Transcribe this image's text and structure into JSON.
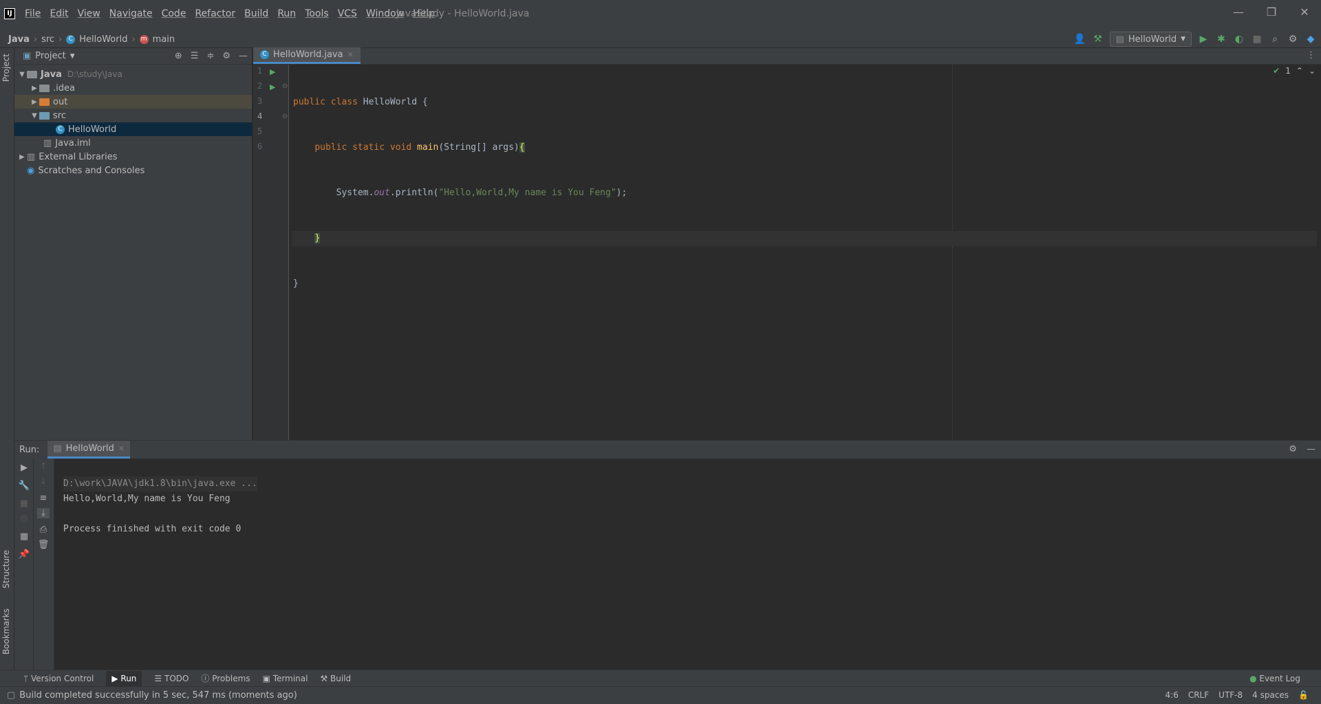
{
  "window": {
    "title": "JavaStudy - HelloWorld.java",
    "logo": "IJ",
    "controls": [
      "—",
      "❐",
      "✕"
    ]
  },
  "menu": [
    "File",
    "Edit",
    "View",
    "Navigate",
    "Code",
    "Refactor",
    "Build",
    "Run",
    "Tools",
    "VCS",
    "Window",
    "Help"
  ],
  "breadcrumb": {
    "project": "Java",
    "folder": "src",
    "class": "HelloWorld",
    "method": "main"
  },
  "toolbar": {
    "run_config": "HelloWorld",
    "icons": [
      "user-icon",
      "hammer-icon",
      "run-icon",
      "debug-icon",
      "coverage-icon",
      "stop-icon",
      "search-icon",
      "gear-icon",
      "jetbrains-icon"
    ]
  },
  "side_tabs": {
    "project": "Project",
    "structure": "Structure",
    "bookmarks": "Bookmarks"
  },
  "project_panel": {
    "title": "Project",
    "tree": [
      {
        "label": "Java",
        "hint": "D:\\study\\Java",
        "level": 0,
        "expanded": true
      },
      {
        "label": ".idea",
        "level": 1,
        "expanded": false
      },
      {
        "label": "out",
        "level": 1,
        "expanded": false
      },
      {
        "label": "src",
        "level": 1,
        "expanded": true
      },
      {
        "label": "HelloWorld",
        "level": 2,
        "selected": true
      },
      {
        "label": "Java.iml",
        "level": 1
      },
      {
        "label": "External Libraries",
        "level": 0,
        "expanded": false
      },
      {
        "label": "Scratches and Consoles",
        "level": 0
      }
    ]
  },
  "editor": {
    "tab_label": "HelloWorld.java",
    "line_numbers": [
      "1",
      "2",
      "3",
      "4",
      "5",
      "6"
    ],
    "inspection_count": "1",
    "code": {
      "l1_kw": "public class ",
      "l1_name": "HelloWorld {",
      "l2_indent": "    ",
      "l2_kw": "public static void ",
      "l2_fn": "main",
      "l2_rest": "(String[] args)",
      "l2_brace": "{",
      "l3_indent": "        ",
      "l3_sys": "System.",
      "l3_out": "out",
      "l3_call": ".println(",
      "l3_str": "\"Hello,World,My name is You Feng\"",
      "l3_end": ");",
      "l4_indent": "    ",
      "l4_brace": "}",
      "l5": "}",
      "l6": ""
    }
  },
  "run_panel": {
    "label": "Run:",
    "tab": "HelloWorld",
    "console": {
      "cmd": "D:\\work\\JAVA\\jdk1.8\\bin\\java.exe ...",
      "output": "Hello,World,My name is You Feng",
      "blank": "",
      "exit": "Process finished with exit code 0"
    }
  },
  "bottom_tabs": [
    "Version Control",
    "Run",
    "TODO",
    "Problems",
    "Terminal",
    "Build"
  ],
  "event_log": "Event Log",
  "status": {
    "message": "Build completed successfully in 5 sec, 547 ms (moments ago)",
    "position": "4:6",
    "line_sep": "CRLF",
    "encoding": "UTF-8",
    "indent": "4 spaces"
  }
}
